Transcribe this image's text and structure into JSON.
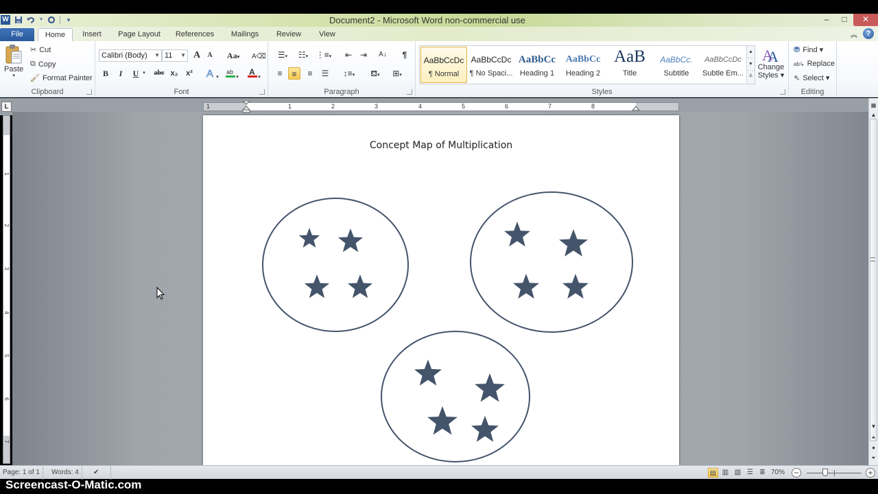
{
  "window": {
    "title": "Document2 - Microsoft Word non-commercial use",
    "app_logo": "W",
    "controls": {
      "minimize": "–",
      "maximize": "□",
      "close": "✕"
    }
  },
  "quick_access": [
    {
      "name": "save-icon",
      "glyph": "▪"
    },
    {
      "name": "undo-icon",
      "glyph": "↶"
    },
    {
      "name": "redo-icon",
      "glyph": "↻"
    },
    {
      "name": "customize-qat-icon",
      "glyph": "▾"
    }
  ],
  "tabs": [
    {
      "label": "File"
    },
    {
      "label": "Home",
      "active": true
    },
    {
      "label": "Insert"
    },
    {
      "label": "Page Layout"
    },
    {
      "label": "References"
    },
    {
      "label": "Mailings"
    },
    {
      "label": "Review"
    },
    {
      "label": "View"
    }
  ],
  "ribbon": {
    "clipboard": {
      "label": "Clipboard",
      "paste": "Paste",
      "cut": "Cut",
      "copy": "Copy",
      "format_painter": "Format Painter"
    },
    "font": {
      "label": "Font",
      "font_name": "Calibri (Body)",
      "font_size": "11",
      "grow": "A",
      "shrink": "A",
      "change_case": "Aa",
      "bold": "B",
      "italic": "I",
      "underline": "U",
      "strikethrough": "abc",
      "subscript": "x₂",
      "superscript": "x²",
      "highlight_color": "#22b14c",
      "font_color": "#d9261c"
    },
    "paragraph": {
      "label": "Paragraph",
      "show_marks": "¶"
    },
    "styles": {
      "label": "Styles",
      "items": [
        {
          "sample": "AaBbCcDc",
          "name": "¶ Normal",
          "selected": true
        },
        {
          "sample": "AaBbCcDc",
          "name": "¶ No Spaci..."
        },
        {
          "sample": "AaBbCc",
          "name": "Heading 1"
        },
        {
          "sample": "AaBbCc",
          "name": "Heading 2"
        },
        {
          "sample": "AaB",
          "name": "Title"
        },
        {
          "sample": "AaBbCc.",
          "name": "Subtitle"
        },
        {
          "sample": "AaBbCcDc",
          "name": "Subtle Em..."
        }
      ],
      "change_styles": "Change Styles ▾"
    },
    "editing": {
      "label": "Editing",
      "find": "Find ▾",
      "replace": "Replace",
      "select": "Select ▾"
    }
  },
  "ruler": {
    "numbers": [
      "1",
      "1",
      "2",
      "3",
      "4",
      "5",
      "6",
      "7",
      "8"
    ],
    "vertical_numbers": [
      "1",
      "2",
      "3",
      "4",
      "5",
      "6",
      "7"
    ],
    "tab_selector": "L"
  },
  "document": {
    "title": "Concept Map of Multiplication",
    "accent_color": "#44546a",
    "groups": [
      {
        "name": "group-1",
        "star_count": 4
      },
      {
        "name": "group-2",
        "star_count": 4
      },
      {
        "name": "group-3",
        "star_count": 4
      }
    ]
  },
  "status": {
    "page": "Page: 1 of 1",
    "words": "Words: 4",
    "zoom": "70%",
    "zoom_percent": 70
  },
  "watermark": "Screencast-O-Matic.com"
}
